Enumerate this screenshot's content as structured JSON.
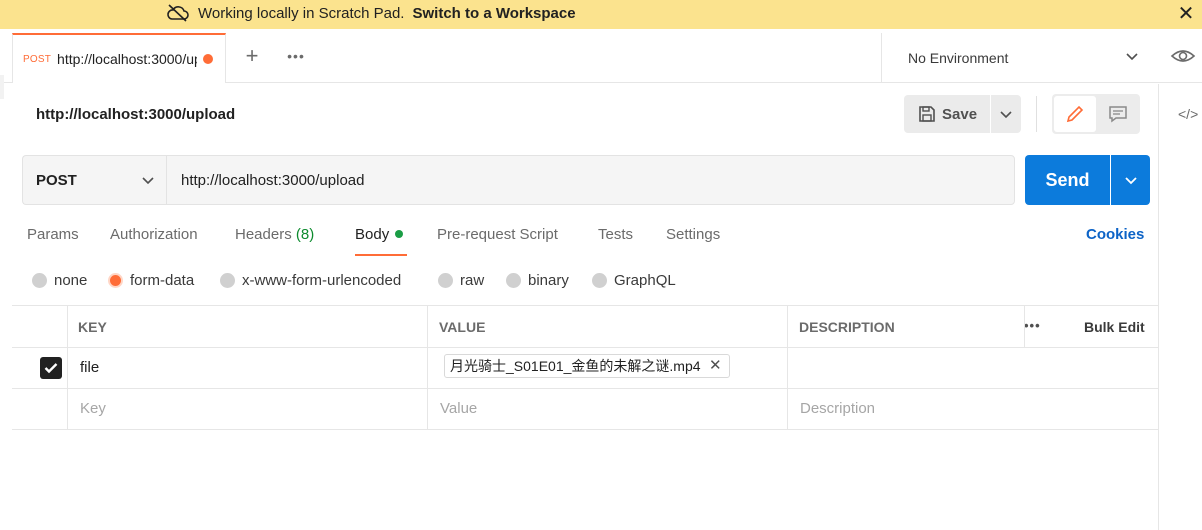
{
  "banner": {
    "message": "Working locally in Scratch Pad.",
    "link": "Switch to a Workspace",
    "cloud_icon": "cloud-off-icon",
    "close_icon": "close-icon"
  },
  "tabbar": {
    "tab": {
      "method": "POST",
      "title": "http://localhost:3000/upload"
    },
    "environment": "No Environment"
  },
  "request": {
    "title": "http://localhost:3000/upload",
    "save_label": "Save",
    "method": "POST",
    "url": "http://localhost:3000/upload",
    "send_label": "Send"
  },
  "request_tabs": [
    {
      "label": "Params"
    },
    {
      "label": "Authorization"
    },
    {
      "label": "Headers",
      "count": "(8)"
    },
    {
      "label": "Body"
    },
    {
      "label": "Pre-request Script"
    },
    {
      "label": "Tests"
    },
    {
      "label": "Settings"
    }
  ],
  "cookies_label": "Cookies",
  "body_types": [
    {
      "label": "none",
      "selected": false
    },
    {
      "label": "form-data",
      "selected": true
    },
    {
      "label": "x-www-form-urlencoded",
      "selected": false
    },
    {
      "label": "raw",
      "selected": false
    },
    {
      "label": "binary",
      "selected": false
    },
    {
      "label": "GraphQL",
      "selected": false
    }
  ],
  "table": {
    "headers": {
      "key": "KEY",
      "value": "VALUE",
      "description": "DESCRIPTION",
      "bulk_edit": "Bulk Edit"
    },
    "rows": [
      {
        "checked": true,
        "key": "file",
        "value": "月光骑士_S01E01_金鱼的未解之谜.mp4",
        "description": ""
      }
    ],
    "placeholders": {
      "key": "Key",
      "value": "Value",
      "description": "Description"
    }
  },
  "colors": {
    "accent": "#ff6c37",
    "primary": "#0c7bdc",
    "banner": "#fbe38e"
  }
}
